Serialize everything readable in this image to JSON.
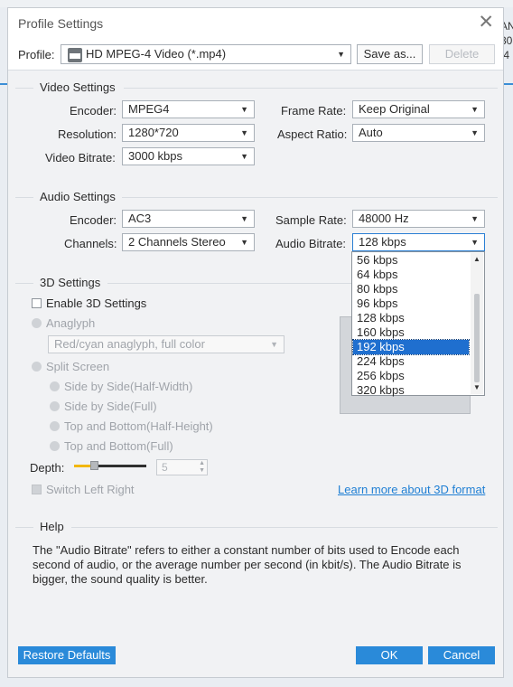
{
  "background": {
    "right_chars": [
      "AN",
      "30",
      ":4"
    ],
    "accent": "#3b8ed6"
  },
  "dialog": {
    "title": "Profile Settings",
    "close_icon": "✕"
  },
  "profile": {
    "label": "Profile:",
    "value": "HD MPEG-4 Video (*.mp4)",
    "icon": "mp4-file-icon",
    "save_as": "Save as...",
    "delete": "Delete"
  },
  "video": {
    "title": "Video Settings",
    "encoder_label": "Encoder:",
    "encoder": "MPEG4",
    "resolution_label": "Resolution:",
    "resolution": "1280*720",
    "bitrate_label": "Video Bitrate:",
    "bitrate": "3000 kbps",
    "framerate_label": "Frame Rate:",
    "framerate": "Keep Original",
    "aspect_label": "Aspect Ratio:",
    "aspect": "Auto"
  },
  "audio": {
    "title": "Audio Settings",
    "encoder_label": "Encoder:",
    "encoder": "AC3",
    "channels_label": "Channels:",
    "channels": "2 Channels Stereo",
    "samplerate_label": "Sample Rate:",
    "samplerate": "48000 Hz",
    "bitrate_label": "Audio Bitrate:",
    "bitrate": "128 kbps",
    "bitrate_options": [
      "56 kbps",
      "64 kbps",
      "80 kbps",
      "96 kbps",
      "128 kbps",
      "160 kbps",
      "192 kbps",
      "224 kbps",
      "256 kbps",
      "320 kbps"
    ],
    "highlighted_option": "192 kbps"
  },
  "three_d": {
    "title": "3D Settings",
    "enable": "Enable 3D Settings",
    "anaglyph": "Anaglyph",
    "anaglyph_option": "Red/cyan anaglyph, full color",
    "split_screen": "Split Screen",
    "sbs_half": "Side by Side(Half-Width)",
    "sbs_full": "Side by Side(Full)",
    "tb_half": "Top and Bottom(Half-Height)",
    "tb_full": "Top and Bottom(Full)",
    "depth_label": "Depth:",
    "depth_value": "5",
    "switch": "Switch Left Right",
    "learn_more": "Learn more about 3D format"
  },
  "help": {
    "title": "Help",
    "text": "The \"Audio Bitrate\" refers to either a constant number of bits used to Encode each second of audio, or the average number per second (in kbit/s). The Audio Bitrate is bigger, the sound quality is better."
  },
  "buttons": {
    "restore": "Restore Defaults",
    "ok": "OK",
    "cancel": "Cancel",
    "color": "#2a8ad9"
  }
}
